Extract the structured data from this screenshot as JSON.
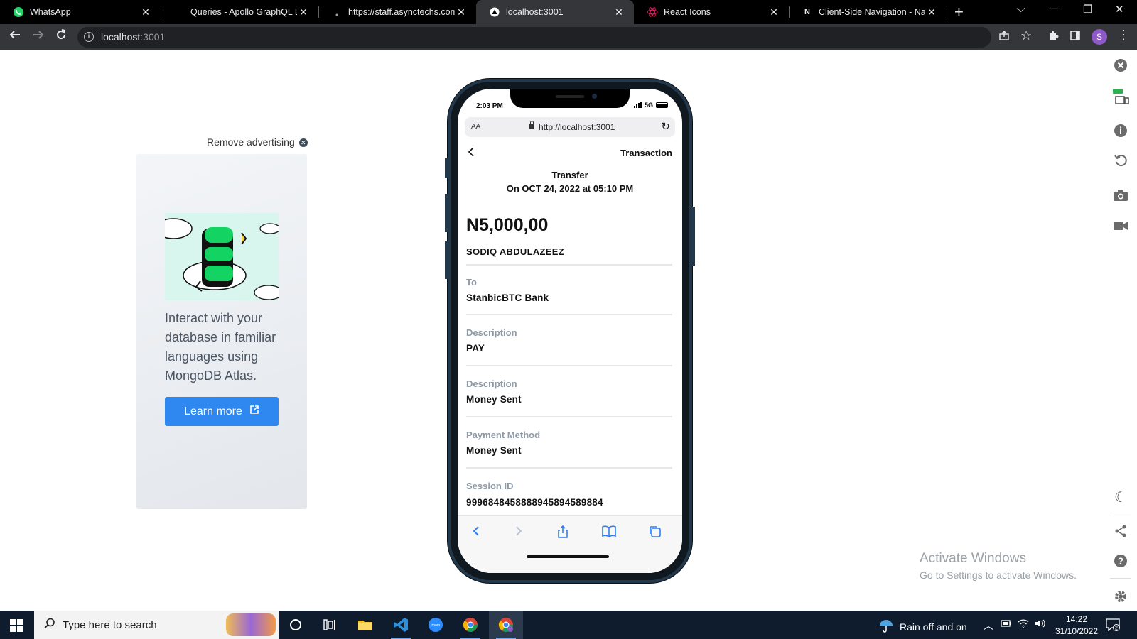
{
  "browser": {
    "tabs": [
      {
        "title": "WhatsApp",
        "icon": "whatsapp-icon"
      },
      {
        "title": "Queries - Apollo GraphQL Do",
        "icon": "apollo-icon"
      },
      {
        "title": "https://staff.asynctechs.com/",
        "icon": "loading-icon"
      },
      {
        "title": "localhost:3001",
        "icon": "vercel-icon",
        "active": true
      },
      {
        "title": "React Icons",
        "icon": "react-icon"
      },
      {
        "title": "Client-Side Navigation - Navi",
        "icon": "nextjs-icon"
      }
    ],
    "address": {
      "host": "localhost",
      "port": ":3001"
    },
    "profile_initial": "S",
    "colors": {
      "tab_strip": "#000000",
      "toolbar": "#35363a",
      "avatar": "#8e5ac8"
    }
  },
  "ad": {
    "remove_label": "Remove advertising",
    "text": "Interact with your database in familiar languages using MongoDB Atlas.",
    "button_label": "Learn more",
    "button_color": "#2f87f0"
  },
  "phone": {
    "status": {
      "time": "2:03 PM",
      "network": "5G"
    },
    "safari": {
      "aa": "AA",
      "url": "http://localhost:3001"
    },
    "page": {
      "title": "Transaction",
      "type": "Transfer",
      "date": "On OCT 24, 2022 at 05:10 PM",
      "amount": "N5,000,00",
      "name": "SODIQ ABDULAZEEZ",
      "fields": [
        {
          "label": "To",
          "value": "StanbicBTC Bank"
        },
        {
          "label": "Description",
          "value": "PAY"
        },
        {
          "label": "Description",
          "value": "Money Sent"
        },
        {
          "label": "Payment Method",
          "value": "Money Sent"
        },
        {
          "label": "Session ID",
          "value": "9996848458888945894589884"
        }
      ]
    }
  },
  "watermark": {
    "title": "Activate Windows",
    "subtitle": "Go to Settings to activate Windows."
  },
  "taskbar": {
    "search_placeholder": "Type here to search",
    "weather": "Rain off and on",
    "time": "14:22",
    "date": "31/10/2022",
    "notifications": "2"
  }
}
